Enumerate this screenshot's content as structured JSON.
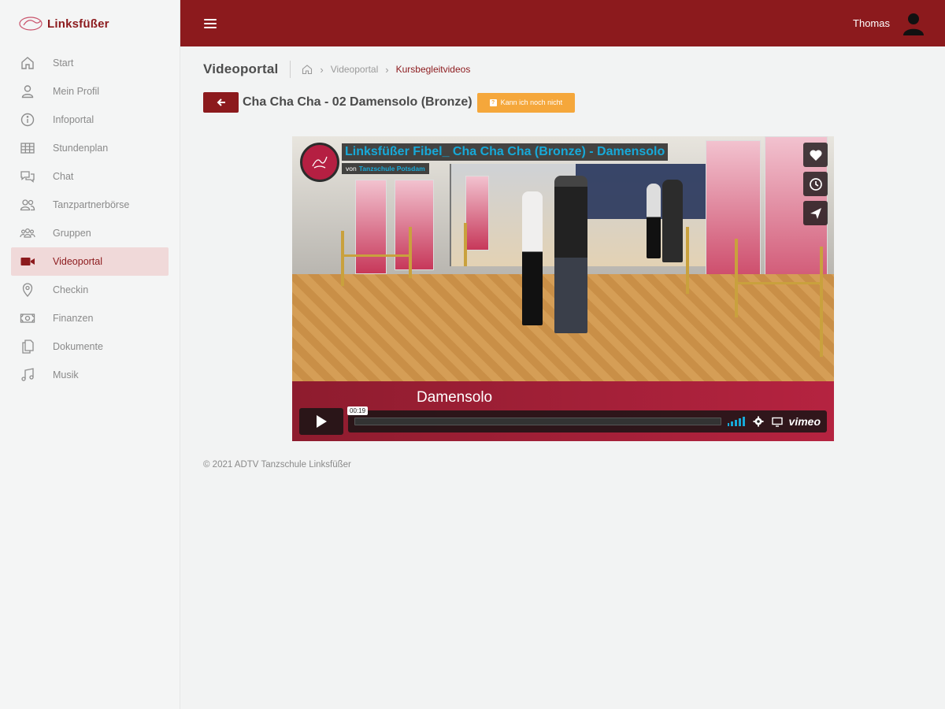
{
  "brand": {
    "name": "Linksfüßer"
  },
  "sidebar": {
    "items": [
      {
        "label": "Start",
        "icon": "home-icon",
        "active": false
      },
      {
        "label": "Mein Profil",
        "icon": "user-icon",
        "active": false
      },
      {
        "label": "Infoportal",
        "icon": "info-icon",
        "active": false
      },
      {
        "label": "Stundenplan",
        "icon": "grid-icon",
        "active": false
      },
      {
        "label": "Chat",
        "icon": "chat-icon",
        "active": false
      },
      {
        "label": "Tanzpartnerbörse",
        "icon": "users-icon",
        "active": false
      },
      {
        "label": "Gruppen",
        "icon": "groups-icon",
        "active": false
      },
      {
        "label": "Videoportal",
        "icon": "video-icon",
        "active": true
      },
      {
        "label": "Checkin",
        "icon": "location-pin-icon",
        "active": false
      },
      {
        "label": "Finanzen",
        "icon": "money-icon",
        "active": false
      },
      {
        "label": "Dokumente",
        "icon": "documents-icon",
        "active": false
      },
      {
        "label": "Musik",
        "icon": "music-icon",
        "active": false
      }
    ]
  },
  "header": {
    "user_name": "Thomas"
  },
  "page": {
    "title": "Videoportal",
    "breadcrumb": [
      "Videoportal",
      "Kursbegleitvideos"
    ]
  },
  "video": {
    "title": "Cha Cha Cha - 02 Damensolo (Bronze)",
    "cant_button": "Kann ich noch nicht",
    "player_title": "Linksfüßer Fibel_ Cha Cha Cha (Bronze) - Damensolo",
    "by_label": "von",
    "channel": "Tanzschule Potsdam",
    "band_text": "Damensolo",
    "timecode": "00:19",
    "progress": 0.0,
    "brand": "vimeo"
  },
  "footer": {
    "text": "© 2021 ADTV Tanzschule Linksfüßer"
  },
  "colors": {
    "primary": "#8c1a1d",
    "accent": "#f5a73b",
    "vimeo_blue": "#17a9d8"
  }
}
